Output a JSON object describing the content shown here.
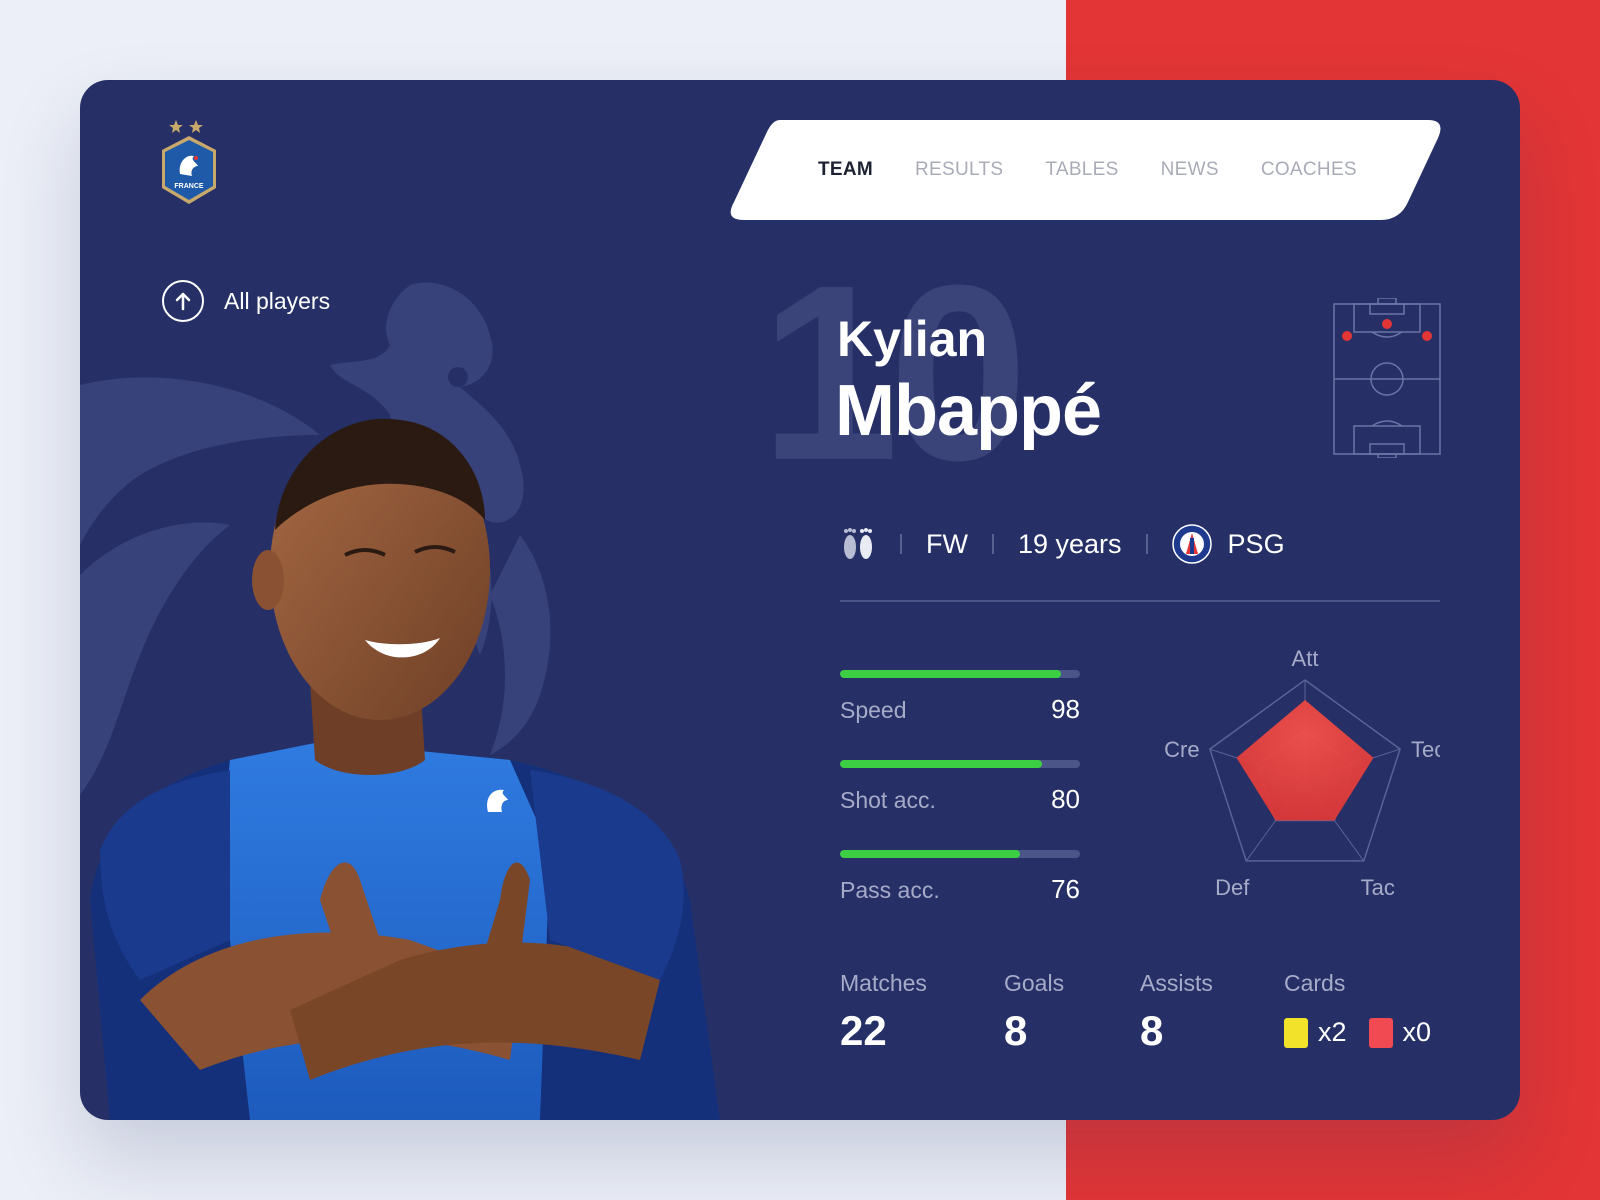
{
  "nav": {
    "items": [
      "TEAM",
      "RESULTS",
      "TABLES",
      "NEWS",
      "COACHES"
    ],
    "active": "TEAM"
  },
  "crest": {
    "text": "FRANCE"
  },
  "back": {
    "label": "All players"
  },
  "player": {
    "number": "10",
    "first_name": "Kylian",
    "last_name": "Mbappé",
    "position": "FW",
    "age": "19 years",
    "club": "PSG"
  },
  "bars": [
    {
      "label": "Speed",
      "value": "98",
      "fill": 0.92
    },
    {
      "label": "Shot acc.",
      "value": "80",
      "fill": 0.84
    },
    {
      "label": "Pass acc.",
      "value": "76",
      "fill": 0.75
    }
  ],
  "radar": {
    "axes": [
      "Att",
      "Tec",
      "Tac",
      "Def",
      "Cre"
    ],
    "values": [
      0.8,
      0.72,
      0.5,
      0.5,
      0.72
    ]
  },
  "summary": {
    "matches": {
      "label": "Matches",
      "value": "22"
    },
    "goals": {
      "label": "Goals",
      "value": "8"
    },
    "assists": {
      "label": "Assists",
      "value": "8"
    },
    "cards": {
      "label": "Cards",
      "yellow": "x2",
      "red": "x0"
    }
  },
  "colors": {
    "card_bg": "#263066",
    "accent_red": "#e33535",
    "bar_green": "#3ccf43",
    "yellow_card": "#f2e22a",
    "red_card": "#f24a52"
  }
}
